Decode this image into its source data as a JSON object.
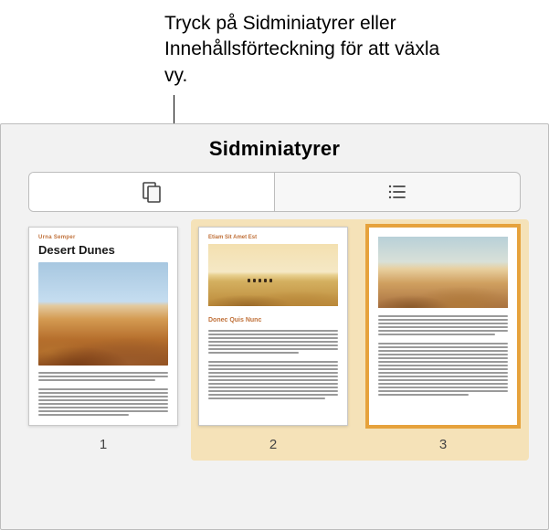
{
  "callout": {
    "text": "Tryck på Sidminiatyrer eller Innehållsförteckning för att växla vy."
  },
  "panel": {
    "title": "Sidminiatyrer"
  },
  "segmented": {
    "thumbnails_icon": "thumbnails-icon",
    "toc_icon": "toc-icon"
  },
  "pages": [
    {
      "number": "1",
      "subtitle": "Urna Semper",
      "title": "Desert Dunes"
    },
    {
      "number": "2",
      "subtitle": "Etiam Sit Amet Est",
      "heading": "Donec Quis Nunc"
    },
    {
      "number": "3"
    }
  ]
}
